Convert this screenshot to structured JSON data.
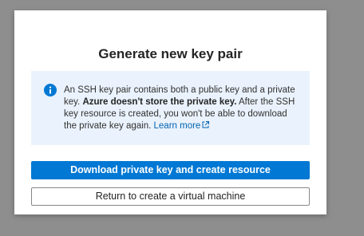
{
  "dialog": {
    "title": "Generate new key pair",
    "info": {
      "text_part1": "An SSH key pair contains both a public key and a private key. ",
      "text_bold": "Azure doesn't store the private key.",
      "text_part2": " After the SSH key resource is created, you won't be able to download the private key again. ",
      "link_label": "Learn more",
      "icon": "info-circle-icon",
      "link_icon": "external-link-icon"
    },
    "primary_button_label": "Download private key and create resource",
    "secondary_button_label": "Return to create a virtual machine"
  },
  "colors": {
    "accent": "#0078d4",
    "info_background": "#eaf2fd",
    "link": "#0063b1",
    "overlay": "#8e8e8e"
  }
}
